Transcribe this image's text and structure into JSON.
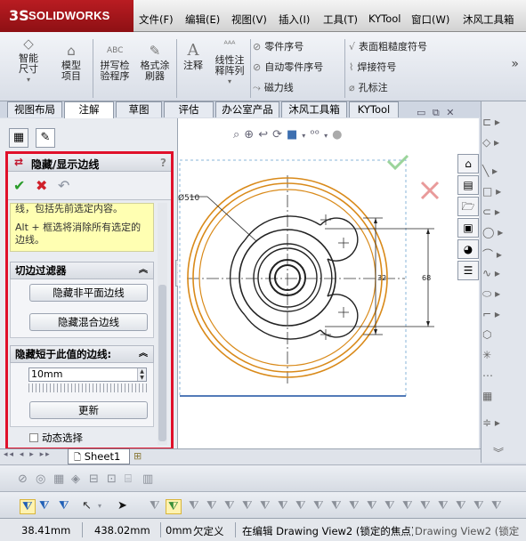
{
  "app": {
    "logo_mark": "3S",
    "logo_name": "SOLIDWORKS"
  },
  "menu": [
    "文件(F)",
    "编辑(E)",
    "视图(V)",
    "插入(I)",
    "工具(T)",
    "KYTool",
    "窗口(W)",
    "沐风工具箱"
  ],
  "commands": {
    "smart_dim": "智能尺寸",
    "model_items": "模型项目",
    "spell_check": "拼写检验程序",
    "format_painter": "格式涂刷器",
    "note": "注释",
    "linear_pattern": "线性注释阵列",
    "balloon": "零件序号",
    "auto_balloon": "自动零件序号",
    "magnetic_line": "磁力线",
    "surface_finish": "表面粗糙度符号",
    "weld_symbol": "焊接符号",
    "hole_callout": "孔标注",
    "more": "»"
  },
  "tabs": [
    "视图布局",
    "注解",
    "草图",
    "评估",
    "办公室产品",
    "沐风工具箱",
    "KYTool"
  ],
  "active_tab": "注解",
  "property_manager": {
    "title": "隐藏/显示边线",
    "help": "?",
    "ok_icon": "✔",
    "cancel_icon": "✖",
    "undo_icon": "↶",
    "message_line1": "线，包括先前选定内容。",
    "message_line2": "Alt + 框选将消除所有选定的边线。",
    "edge_filter_title": "切边过滤器",
    "hide_nonplanar_btn": "隐藏非平面边线",
    "hide_blend_btn": "隐藏混合边线",
    "hide_short_title": "隐藏短于此值的边线:",
    "length_value": "10mm",
    "update_btn": "更新",
    "dynamic_select": "动态选择"
  },
  "drawing": {
    "dim_diameter": "Ø510",
    "dim_32": "32",
    "dim_68": "68"
  },
  "sheet_tab": "Sheet1",
  "status": {
    "x": "38.41mm",
    "y": "438.02mm",
    "z": "0mm",
    "state": "欠定义",
    "editing": "在编辑 Drawing View2 (锁定的焦点)",
    "overflow": "Drawing View2 (锁定"
  },
  "colors": {
    "brand_red": "#b91c22",
    "highlight_frame": "#e0102a",
    "part_orange": "#d98a1a",
    "ok_green": "#2a9c2a",
    "cancel_red": "#d0202a"
  }
}
